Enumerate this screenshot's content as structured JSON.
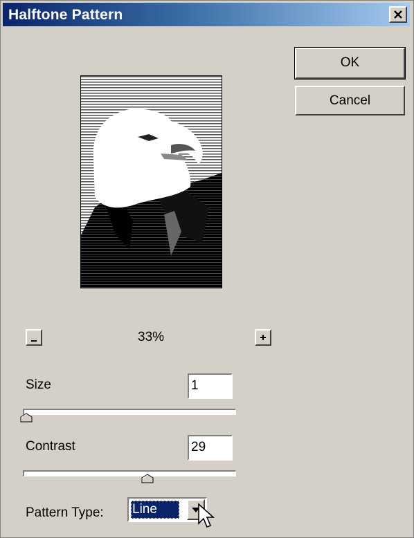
{
  "window": {
    "title": "Halftone Pattern",
    "close_glyph": "✕"
  },
  "buttons": {
    "ok": "OK",
    "cancel": "Cancel"
  },
  "preview": {
    "image": "bald-eagle-halftone-preview"
  },
  "zoom": {
    "minus": "−",
    "level": "33%",
    "plus": "+"
  },
  "size": {
    "label": "Size",
    "value": "1",
    "slider_fraction": 0.0
  },
  "contrast": {
    "label": "Contrast",
    "value": "29",
    "slider_fraction": 0.58
  },
  "pattern_type": {
    "label": "Pattern Type:",
    "selected": "Line"
  },
  "icons": {
    "close": "close-icon",
    "dropdown": "chevron-down-icon",
    "cursor": "mouse-pointer-icon"
  },
  "colors": {
    "titlebar": "#0a246a",
    "face": "#d4d0c8",
    "selection": "#0a246a"
  }
}
